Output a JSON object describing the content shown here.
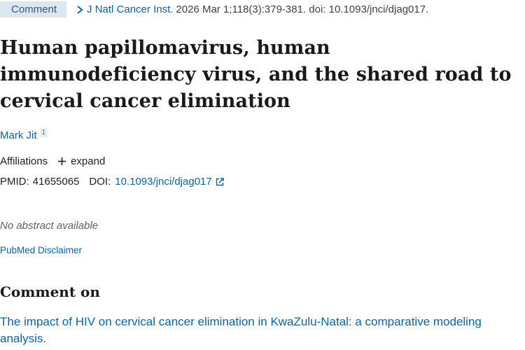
{
  "header": {
    "badge": "Comment",
    "journal": "J Natl Cancer Inst.",
    "citation": "2026 Mar 1;118(3):379-381. doi: 10.1093/jnci/djag017."
  },
  "article": {
    "title": "Human papillomavirus, human immunodeficiency virus, and the shared road to cervical cancer elimination",
    "author": "Mark Jit",
    "author_affiliation_number": "1",
    "affiliations_label": "Affiliations",
    "expand_label": "expand",
    "pmid_label": "PMID:",
    "pmid": "41655065",
    "doi_label": "DOI:",
    "doi": "10.1093/jnci/djag017",
    "no_abstract": "No abstract available",
    "disclaimer": "PubMed Disclaimer"
  },
  "comment_on": {
    "heading": "Comment on",
    "link_text": "The impact of HIV on cervical cancer elimination in KwaZulu-Natal: a comparative modeling analysis."
  },
  "colors": {
    "link": "#0b63a7",
    "badge_bg": "#dfe7ee",
    "badge_text": "#2b5b86"
  }
}
